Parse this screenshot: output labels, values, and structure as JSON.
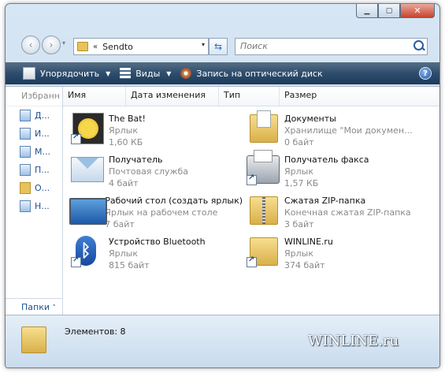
{
  "window": {
    "controls": {
      "minimize": "▁",
      "maximize": "▢",
      "close": "✕"
    }
  },
  "navbar": {
    "back_icon": "‹",
    "forward_icon": "›",
    "history_icon": "▾",
    "address": {
      "chevron": "«",
      "path": "Sendto",
      "dropdown": "▾"
    },
    "refresh_icon": "⇆",
    "search": {
      "placeholder": "Поиск"
    }
  },
  "toolbar": {
    "organize": "Упорядочить",
    "views": "Виды",
    "burn": "Запись на оптический диск",
    "dropdown_arrow": "▼",
    "help": "?"
  },
  "nav_pane": {
    "header": "Избранн",
    "items": [
      {
        "label": "Д...",
        "icon": "documents-icon"
      },
      {
        "label": "И...",
        "icon": "pictures-icon"
      },
      {
        "label": "М...",
        "icon": "music-icon"
      },
      {
        "label": "П...",
        "icon": "searches-icon"
      },
      {
        "label": "О...",
        "icon": "folder-icon"
      },
      {
        "label": "Н...",
        "icon": "network-icon"
      }
    ],
    "folders_label": "Папки",
    "folders_arrow": "˄"
  },
  "columns": [
    "Имя",
    "Дата изменения",
    "Тип",
    "Размер"
  ],
  "files": [
    {
      "name": "The Bat!",
      "type": "Ярлык",
      "size": "1,60 КБ",
      "icon": "thebat-icon",
      "shortcut": true
    },
    {
      "name": "Документы",
      "type": "Хранилище \"Мои докумен...",
      "size": "0 байт",
      "icon": "documents-folder-icon",
      "shortcut": false
    },
    {
      "name": "Получатель",
      "type": "Почтовая служба",
      "size": "4 байт",
      "icon": "mail-recipient-icon",
      "shortcut": false
    },
    {
      "name": "Получатель факса",
      "type": "Ярлык",
      "size": "1,57 КБ",
      "icon": "fax-icon",
      "shortcut": true
    },
    {
      "name": "Рабочий стол (создать ярлык)",
      "type": "Ярлык на рабочем столе",
      "size": "7 байт",
      "icon": "desktop-icon",
      "shortcut": false
    },
    {
      "name": "Сжатая ZIP-папка",
      "type": "Конечная сжатая ZIP-папка",
      "size": "3 байт",
      "icon": "zip-folder-icon",
      "shortcut": false
    },
    {
      "name": "Устройство Bluetooth",
      "type": "Ярлык",
      "size": "815 байт",
      "icon": "bluetooth-icon",
      "shortcut": true
    },
    {
      "name": "WINLINE.ru",
      "type": "Ярлык",
      "size": "374 байт",
      "icon": "folder-shortcut-icon",
      "shortcut": true
    }
  ],
  "status": {
    "count": "Элементов: 8"
  },
  "watermark": "WINLINE.ru"
}
